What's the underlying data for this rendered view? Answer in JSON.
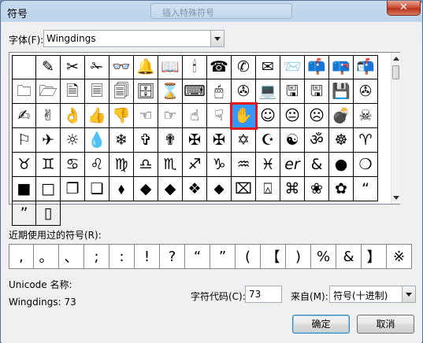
{
  "window": {
    "title": "符号",
    "close_glyph": "✕"
  },
  "font": {
    "label": "字体(F):",
    "value": "Wingdings"
  },
  "symbols": [
    " ",
    "✎",
    "✂",
    "✁",
    "👓",
    "🔔",
    "📖",
    "🕯",
    "☎",
    "✆",
    "✉",
    "📨",
    "📫",
    "📪",
    "📬",
    "🗀",
    "🗁",
    "🗎",
    "🗏",
    "🗐",
    "🗄",
    "⌛",
    "⌨",
    "🖱",
    "✇",
    "💻",
    "🖫",
    "🖫",
    "💾",
    "✇",
    "✍",
    "✌",
    "👌",
    "👍",
    "👎",
    "☜",
    "☞",
    "☝",
    "☟",
    "✋",
    "☺",
    "😐",
    "☹",
    "💣",
    "☠",
    "⚐",
    "✈",
    "☼",
    "💧",
    "❄",
    "✞",
    "✟",
    "✠",
    "✠",
    "✡",
    "☪",
    "☯",
    "ॐ",
    "☸",
    "♈",
    "♉",
    "♊",
    "♋",
    "♌",
    "♍",
    "♎",
    "♏",
    "♐",
    "♑",
    "♒",
    "♓",
    "er",
    "&",
    "●",
    "❍",
    "■",
    "□",
    "❐",
    "❑",
    "⬧",
    "◆",
    "◆",
    "❖",
    "⬥",
    "⌧",
    "⍓",
    "⌘",
    "❀",
    "✿",
    "“",
    "”",
    "▯"
  ],
  "selected_index": 39,
  "recent": {
    "label": "近期使用过的符号(R):",
    "items": [
      ",",
      "。",
      "、",
      ";",
      ":",
      "!",
      "?",
      "“",
      "”",
      "(",
      "【",
      ")",
      "%",
      "&",
      "】",
      "※"
    ]
  },
  "unicode": {
    "name_label": "Unicode 名称:",
    "name_value": "Wingdings: 73"
  },
  "char_code": {
    "label": "字符代码(C):",
    "value": "73"
  },
  "from": {
    "label": "来自(M):",
    "value": "符号(十进制)"
  },
  "buttons": {
    "ok": "确定",
    "cancel": "取消"
  },
  "ghost_tab_text": "插入特殊符号",
  "colors": {
    "selected_cell": "#3399ff",
    "selection_outline": "#e4161b"
  }
}
